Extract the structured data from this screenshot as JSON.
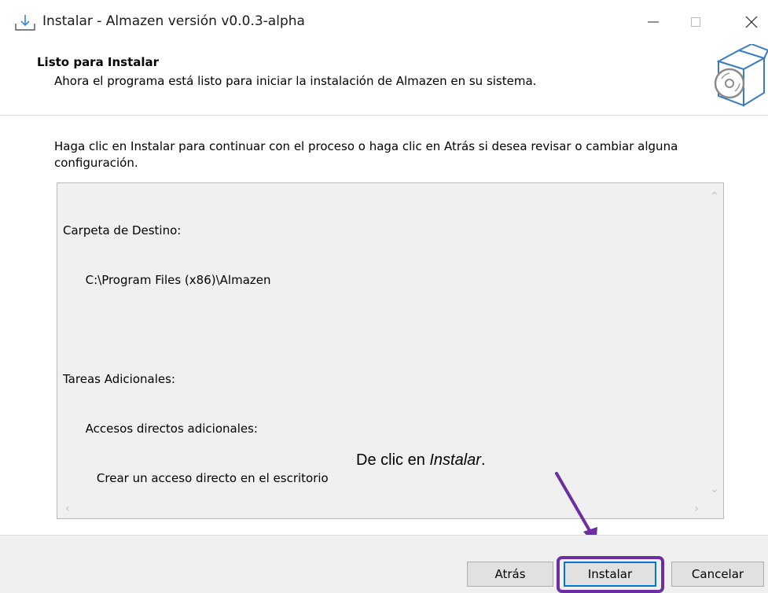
{
  "window": {
    "title": "Instalar - Almazen versión v0.0.3-alpha",
    "icons": {
      "app": "install-download-icon",
      "minimize": "minimize-icon",
      "maximize": "maximize-icon",
      "close": "close-icon"
    }
  },
  "header": {
    "title": "Listo para Instalar",
    "subtitle": "Ahora el programa está listo para iniciar la instalación de Almazen en su sistema.",
    "icon": "setup-box-icon"
  },
  "body": {
    "instruction": "Haga clic en Instalar para continuar con el proceso o haga clic en Atrás si desea revisar o cambiar alguna configuración."
  },
  "memo": {
    "lines": [
      "Carpeta de Destino:",
      "      C:\\Program Files (x86)\\Almazen",
      "",
      "Tareas Adicionales:",
      "      Accesos directos adicionales:",
      "         Crear un acceso directo en el escritorio"
    ]
  },
  "annotation": {
    "text_prefix": "De clic en ",
    "text_emphasis": "Instalar",
    "text_suffix": ".",
    "color": "#6b2fa3"
  },
  "footer": {
    "back_label": "Atrás",
    "install_label": "Instalar",
    "cancel_label": "Cancelar"
  },
  "colors": {
    "accent": "#0078d7",
    "annotation": "#6b2fa3",
    "panel": "#f0f0f0"
  }
}
